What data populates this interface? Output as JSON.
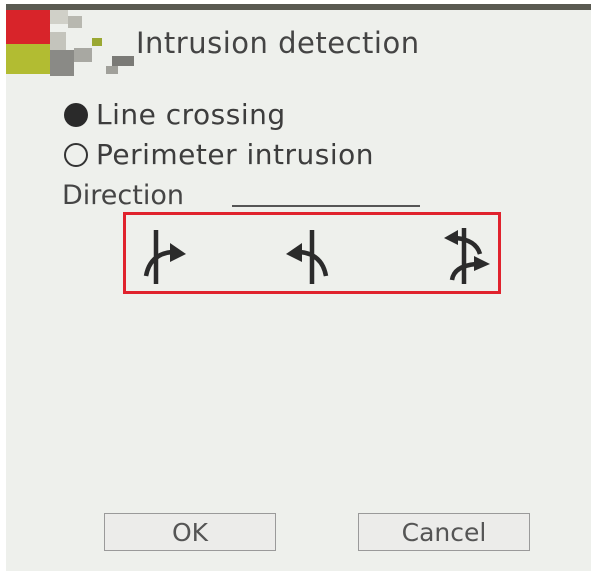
{
  "dialog": {
    "title": "Intrusion detection",
    "modes": [
      {
        "label": "Line crossing",
        "selected": true
      },
      {
        "label": "Perimeter intrusion",
        "selected": false
      }
    ],
    "direction_label": "Direction",
    "direction_options": [
      {
        "icon": "arrow-right-crossing-icon"
      },
      {
        "icon": "arrow-left-crossing-icon"
      },
      {
        "icon": "bidirectional-crossing-icon"
      }
    ],
    "ok_label": "OK",
    "cancel_label": "Cancel"
  },
  "colors": {
    "background": "#eef0ec",
    "highlight": "#e0222d",
    "logo_red": "#d8242a",
    "logo_olive": "#9aa832"
  }
}
